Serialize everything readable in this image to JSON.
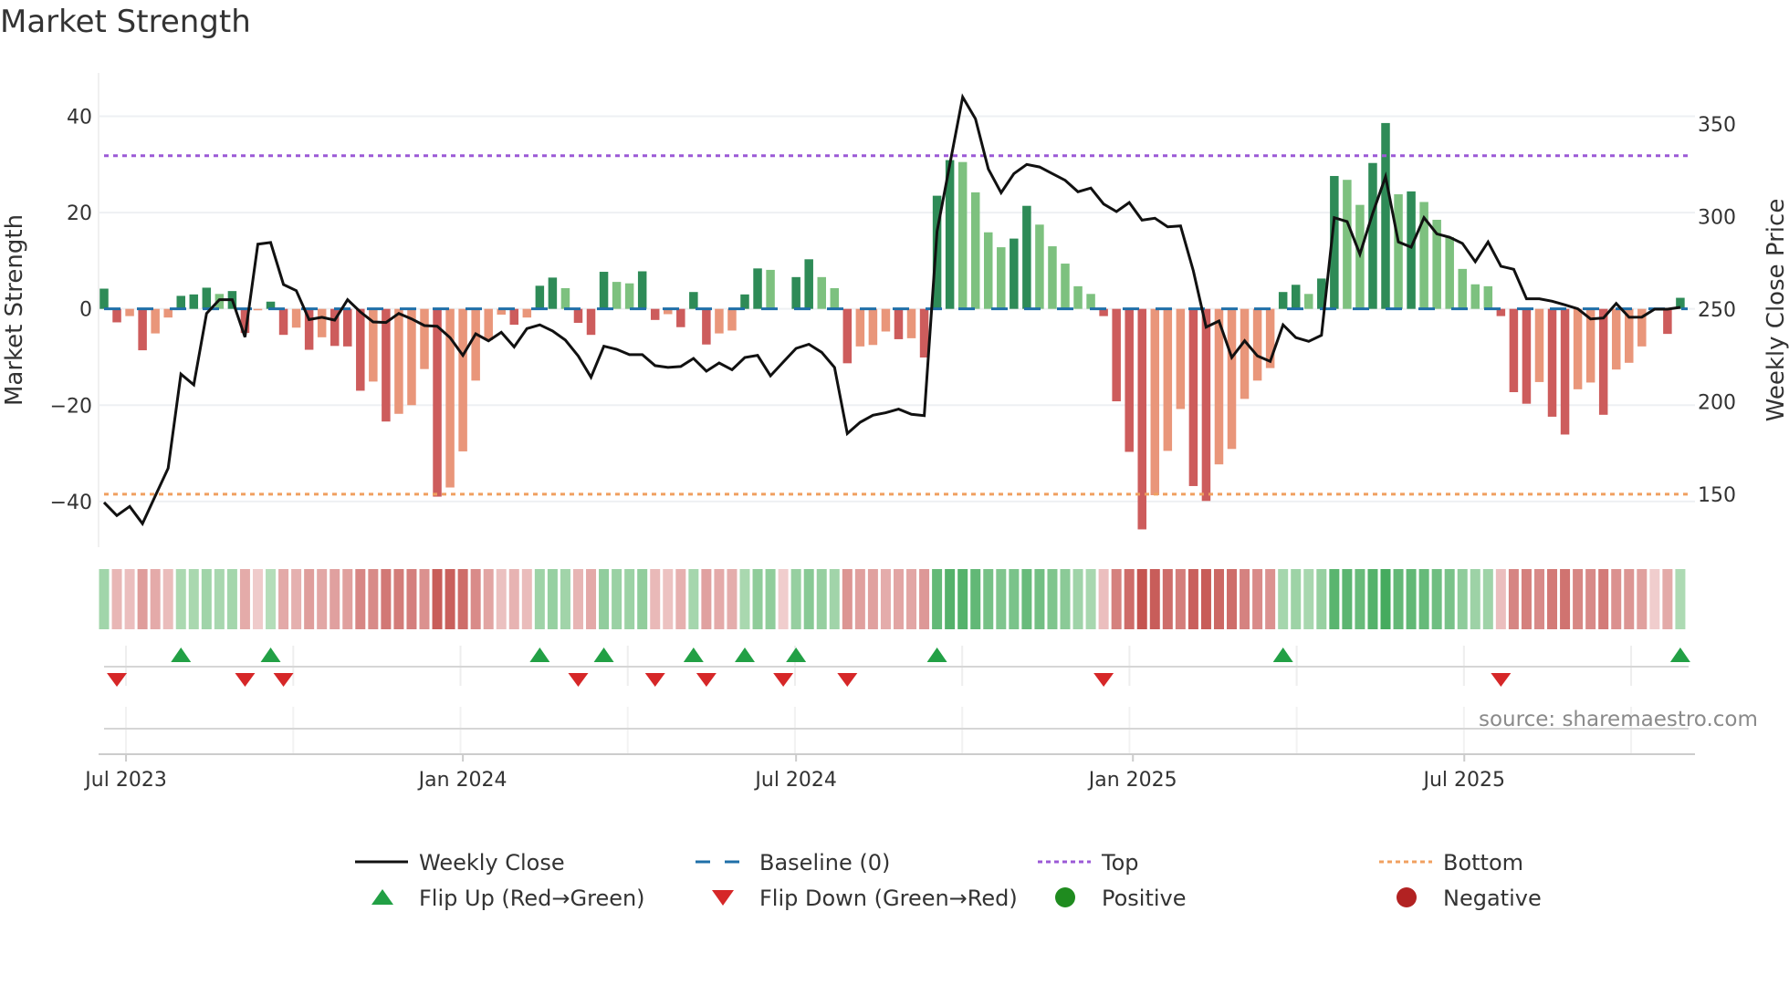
{
  "title": "Market Strength",
  "source": "source: sharemaestro.com",
  "colors": {
    "green_dark": "#2e8b57",
    "green_light": "#7dc17f",
    "red_dark": "#cd5c5c",
    "red_light": "#e9967a",
    "line": "#111111",
    "baseline": "#1f6fa8",
    "top": "#9b59d6",
    "bottom": "#f0a060",
    "flip_up": "#22a045",
    "flip_down": "#d62728",
    "positive": "#1f8b1f",
    "negative": "#b22222"
  },
  "chart_data": {
    "type": "bar",
    "title": "Market Strength",
    "start_date": "2023-06-19",
    "interval_days": 7,
    "ylabel": "Market Strength",
    "y2label": "Weekly Close Price",
    "ylim": [
      -49.5,
      49
    ],
    "y2lim": [
      121.4,
      377.6
    ],
    "yticks": [
      {
        "v": 40,
        "label": "40"
      },
      {
        "v": 20,
        "label": "20"
      },
      {
        "v": 0,
        "label": "0"
      },
      {
        "v": -20,
        "label": "−20"
      },
      {
        "v": -40,
        "label": "−40"
      }
    ],
    "y2ticks": [
      {
        "v": 350,
        "label": "350"
      },
      {
        "v": 300,
        "label": "300"
      },
      {
        "v": 250,
        "label": "250"
      },
      {
        "v": 200,
        "label": "200"
      },
      {
        "v": 150,
        "label": "150"
      }
    ],
    "xticks": [
      {
        "date": "2023-07-01",
        "label": "Jul 2023"
      },
      {
        "date": "2024-01-01",
        "label": "Jan 2024"
      },
      {
        "date": "2024-07-01",
        "label": "Jul 2024"
      },
      {
        "date": "2025-01-01",
        "label": "Jan 2025"
      },
      {
        "date": "2025-07-01",
        "label": "Jul 2025"
      }
    ],
    "top_level": 31.8,
    "bottom_level": -38.5,
    "baseline": 0,
    "strength": [
      4.2,
      -2.8,
      -1.5,
      -8.6,
      -5.1,
      -1.8,
      2.7,
      3.0,
      4.4,
      3.1,
      3.7,
      -5.0,
      -0.3,
      1.5,
      -5.4,
      -3.9,
      -8.5,
      -5.9,
      -7.7,
      -7.8,
      -17.0,
      -15.1,
      -23.4,
      -21.8,
      -20.0,
      -12.5,
      -39.0,
      -37.1,
      -29.6,
      -14.9,
      -6.5,
      -1.2,
      -3.3,
      -1.8,
      4.8,
      6.5,
      4.3,
      -2.9,
      -5.4,
      7.7,
      5.6,
      5.3,
      7.8,
      -2.3,
      -1.1,
      -3.8,
      3.5,
      -7.4,
      -5.1,
      -4.5,
      3.0,
      8.4,
      8.1,
      -0.2,
      6.6,
      10.3,
      6.6,
      4.3,
      -11.3,
      -7.8,
      -7.5,
      -4.7,
      -6.3,
      -6.1,
      -10.1,
      23.5,
      30.9,
      30.5,
      24.2,
      15.9,
      12.8,
      14.6,
      21.4,
      17.5,
      13.0,
      9.4,
      4.7,
      3.1,
      -1.5,
      -19.2,
      -29.7,
      -45.8,
      -38.7,
      -29.5,
      -20.8,
      -36.8,
      -39.9,
      -32.3,
      -29.1,
      -18.7,
      -14.9,
      -12.3,
      3.5,
      5.0,
      3.1,
      6.3,
      27.6,
      26.8,
      21.6,
      30.3,
      38.6,
      23.8,
      24.4,
      22.2,
      18.5,
      14.9,
      8.3,
      5.1,
      4.7,
      -1.5,
      -17.3,
      -19.7,
      -15.2,
      -22.4,
      -26.1,
      -16.7,
      -15.3,
      -22.0,
      -12.6,
      -11.2,
      -7.8,
      -0.2,
      -5.2,
      2.3
    ],
    "weekly_close": [
      145.6,
      138.5,
      143.4,
      134.1,
      149.2,
      164.0,
      214.9,
      209.1,
      247.7,
      255.1,
      255.1,
      234.9,
      285.1,
      286.0,
      263.3,
      260.0,
      244.4,
      245.6,
      244.1,
      255.1,
      248.5,
      243.1,
      242.8,
      247.7,
      244.7,
      241.1,
      240.8,
      234.6,
      225.0,
      236.7,
      232.9,
      237.5,
      229.6,
      239.5,
      241.5,
      238.2,
      233.3,
      224.7,
      213.2,
      230.0,
      228.3,
      225.4,
      225.4,
      219.5,
      218.5,
      219.0,
      223.4,
      216.5,
      220.9,
      217.3,
      223.9,
      225.0,
      214.0,
      221.4,
      228.8,
      231.0,
      226.7,
      218.5,
      182.8,
      188.9,
      192.7,
      194.0,
      196.0,
      193.2,
      192.5,
      292.0,
      328.2,
      364.6,
      352.8,
      325.7,
      312.9,
      323.2,
      328.2,
      326.8,
      323.2,
      319.6,
      313.4,
      315.4,
      306.8,
      302.7,
      307.6,
      298.1,
      299.1,
      294.5,
      295.0,
      270.7,
      240.3,
      243.6,
      223.9,
      232.9,
      224.7,
      221.8,
      241.5,
      234.6,
      232.6,
      235.9,
      299.4,
      297.3,
      279.7,
      301.9,
      321.6,
      286.3,
      283.5,
      299.4,
      290.7,
      288.8,
      285.5,
      275.6,
      286.3,
      273.2,
      271.5,
      255.6,
      255.6,
      254.3,
      252.3,
      250.2,
      244.7,
      245.2,
      253.1,
      245.6,
      245.7,
      250.0,
      250.0,
      251.0
    ],
    "flip_up_weeks": [
      6,
      13,
      34,
      39,
      46,
      50,
      54,
      65,
      92,
      123
    ],
    "flip_down_weeks": [
      1,
      11,
      14,
      37,
      43,
      47,
      53,
      58,
      78,
      109
    ],
    "legend": {
      "placement": "bottom",
      "items": [
        {
          "key": "weekly_close",
          "label": "Weekly Close"
        },
        {
          "key": "baseline",
          "label": "Baseline (0)"
        },
        {
          "key": "top",
          "label": "Top"
        },
        {
          "key": "bottom",
          "label": "Bottom"
        },
        {
          "key": "flip_up",
          "label": "Flip Up (Red→Green)"
        },
        {
          "key": "flip_down",
          "label": "Flip Down (Green→Red)"
        },
        {
          "key": "positive",
          "label": "Positive"
        },
        {
          "key": "negative",
          "label": "Negative"
        }
      ]
    }
  }
}
